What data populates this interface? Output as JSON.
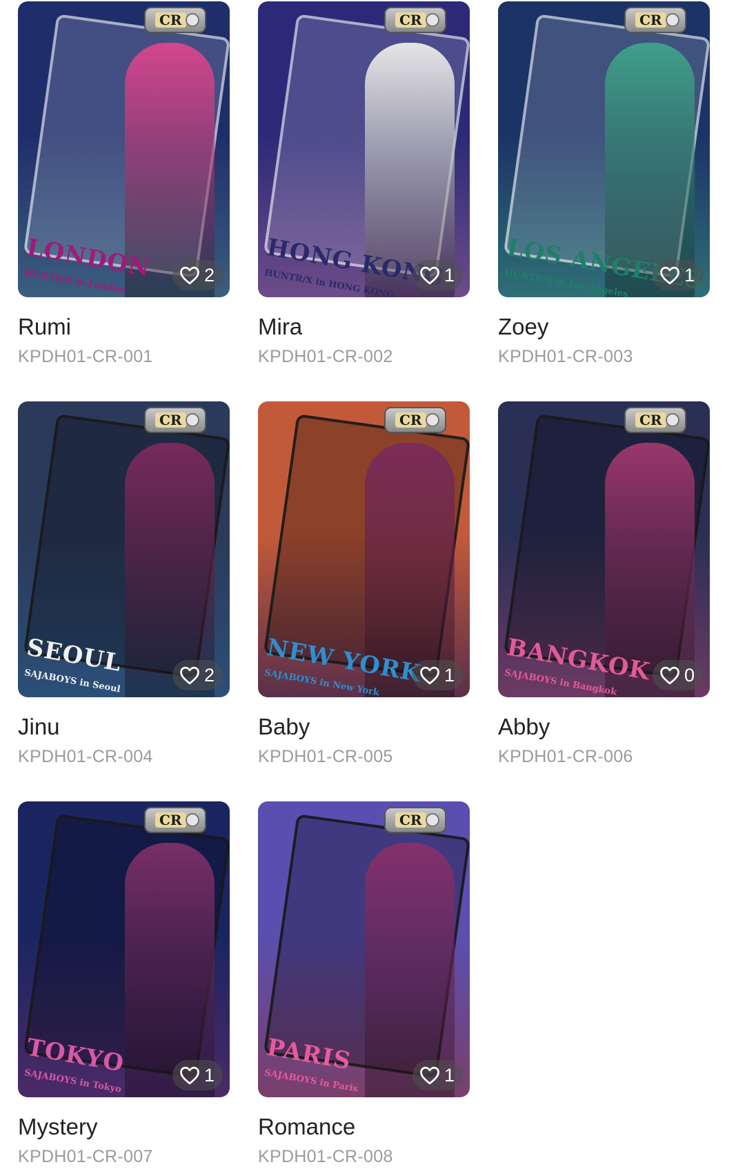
{
  "cards": [
    {
      "name": "Rumi",
      "code": "KPDH01-CR-001",
      "likes": "2",
      "city": "LONDON",
      "subtitle": "HUNTR/X in London",
      "tag": "CR",
      "colors": {
        "sky": "#1f2e6b",
        "ground": "#3b5e7e",
        "city": "#a01a7a",
        "figure": "#e0458f",
        "frame_style": "light"
      }
    },
    {
      "name": "Mira",
      "code": "KPDH01-CR-002",
      "likes": "1",
      "city": "HONG KONG",
      "subtitle": "HUNTR/X in HONG KONG",
      "tag": "CR",
      "colors": {
        "sky": "#2c2a78",
        "ground": "#6d4c88",
        "city": "#2a2a6a",
        "figure": "#f2f2ee",
        "frame_style": "light"
      }
    },
    {
      "name": "Zoey",
      "code": "KPDH01-CR-003",
      "likes": "1",
      "city": "LOS ANGELES",
      "subtitle": "HUNTR/X in Los Angeles",
      "tag": "CR",
      "colors": {
        "sky": "#1c3366",
        "ground": "#2f6f76",
        "city": "#1f7f6a",
        "figure": "#3fa58a",
        "frame_style": "light"
      }
    },
    {
      "name": "Jinu",
      "code": "KPDH01-CR-004",
      "likes": "2",
      "city": "SEOUL",
      "subtitle": "SAJABOYS in Seoul",
      "tag": "CR",
      "colors": {
        "sky": "#2b3a5a",
        "ground": "#2b4f78",
        "city": "#f1f1f1",
        "figure": "#7e2a5e",
        "frame_style": "dark"
      }
    },
    {
      "name": "Baby",
      "code": "KPDH01-CR-005",
      "likes": "1",
      "city": "NEW YORK",
      "subtitle": "SAJABOYS in New York",
      "tag": "CR",
      "colors": {
        "sky": "#c25a3a",
        "ground": "#5a2f4a",
        "city": "#2d8fd0",
        "figure": "#7a2a5c",
        "frame_style": "dark"
      }
    },
    {
      "name": "Abby",
      "code": "KPDH01-CR-006",
      "likes": "0",
      "city": "BANGKOK",
      "subtitle": "SAJABOYS in Bangkok",
      "tag": "CR",
      "colors": {
        "sky": "#2a2f55",
        "ground": "#6c3a64",
        "city": "#e25a98",
        "figure": "#a3386f",
        "frame_style": "dark"
      }
    },
    {
      "name": "Mystery",
      "code": "KPDH01-CR-007",
      "likes": "1",
      "city": "TOKYO",
      "subtitle": "SAJABOYS in Tokyo",
      "tag": "CR",
      "colors": {
        "sky": "#1a2560",
        "ground": "#4a2a66",
        "city": "#d957a8",
        "figure": "#80306a",
        "frame_style": "dark"
      }
    },
    {
      "name": "Romance",
      "code": "KPDH01-CR-008",
      "likes": "1",
      "city": "PARIS",
      "subtitle": "SAJABOYS in Paris",
      "tag": "CR",
      "colors": {
        "sky": "#5a4fb0",
        "ground": "#7a3f6a",
        "city": "#e65aa0",
        "figure": "#8a2f6a",
        "frame_style": "dark"
      }
    }
  ]
}
